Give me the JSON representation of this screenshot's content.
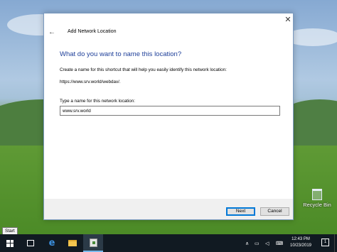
{
  "dialog": {
    "title": "Add Network Location",
    "heading": "What do you want to name this location?",
    "description": "Create a name for this shortcut that will help you easily identify this network location:",
    "url": "https://www.srv.world/webdav/.",
    "field_label": "Type a name for this network location:",
    "field_value": "www.srv.world",
    "back_icon": "back-arrow",
    "close_icon": "close",
    "next_label": "Next",
    "cancel_label": "Cancel"
  },
  "desktop": {
    "recycle_bin_label": "Recycle Bin",
    "tooltip": "Start"
  },
  "taskbar": {
    "time": "12:43 PM",
    "date": "10/23/2019",
    "notifications_count": "1",
    "apps": [
      "windows-start",
      "task-view",
      "edge",
      "file-explorer",
      "network-wizard"
    ]
  }
}
